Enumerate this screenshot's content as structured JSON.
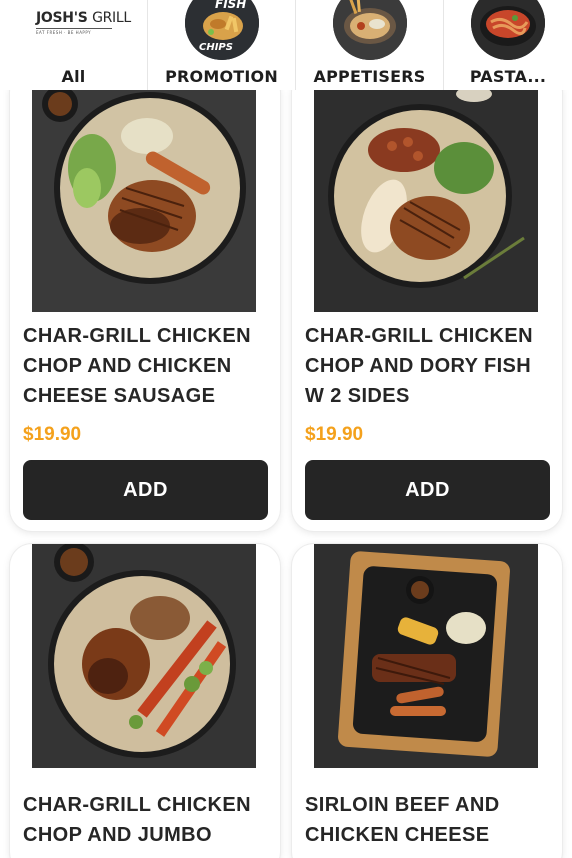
{
  "brand": {
    "name_bold": "JOSH'S",
    "name_thin": "GRILL",
    "tagline": "EAT FRESH · BE HAPPY"
  },
  "categories": [
    {
      "label": "All",
      "icon": "josh-grill-logo"
    },
    {
      "label": "PROMOTION",
      "icon": "fish-and-chips-image",
      "badge_text": "FISH",
      "badge_text2": "CHIPS"
    },
    {
      "label": "APPETISERS",
      "icon": "appetiser-plate-image"
    },
    {
      "label": "PASTA...",
      "icon": "pasta-bowl-image"
    }
  ],
  "products": [
    {
      "title_lines": [
        "CHAR-GRILL CHICKEN",
        "CHOP AND CHICKEN",
        "CHEESE SAUSAGE"
      ],
      "price": "$19.90",
      "button": "ADD",
      "image": "chicken-chop-sausage-plate"
    },
    {
      "title_lines": [
        "CHAR-GRILL CHICKEN",
        "CHOP AND DORY FISH",
        "W 2 SIDES"
      ],
      "price": "$19.90",
      "button": "ADD",
      "image": "chicken-chop-dory-plate"
    },
    {
      "title_lines": [
        "CHAR-GRILL CHICKEN",
        "CHOP AND JUMBO"
      ],
      "image": "chicken-chop-prawn-plate"
    },
    {
      "title_lines": [
        "SIRLOIN BEEF AND",
        "CHICKEN CHEESE"
      ],
      "image": "sirloin-beef-board"
    }
  ],
  "colors": {
    "price": "#f4a11c",
    "button_bg": "#252525",
    "button_text": "#ffffff"
  }
}
